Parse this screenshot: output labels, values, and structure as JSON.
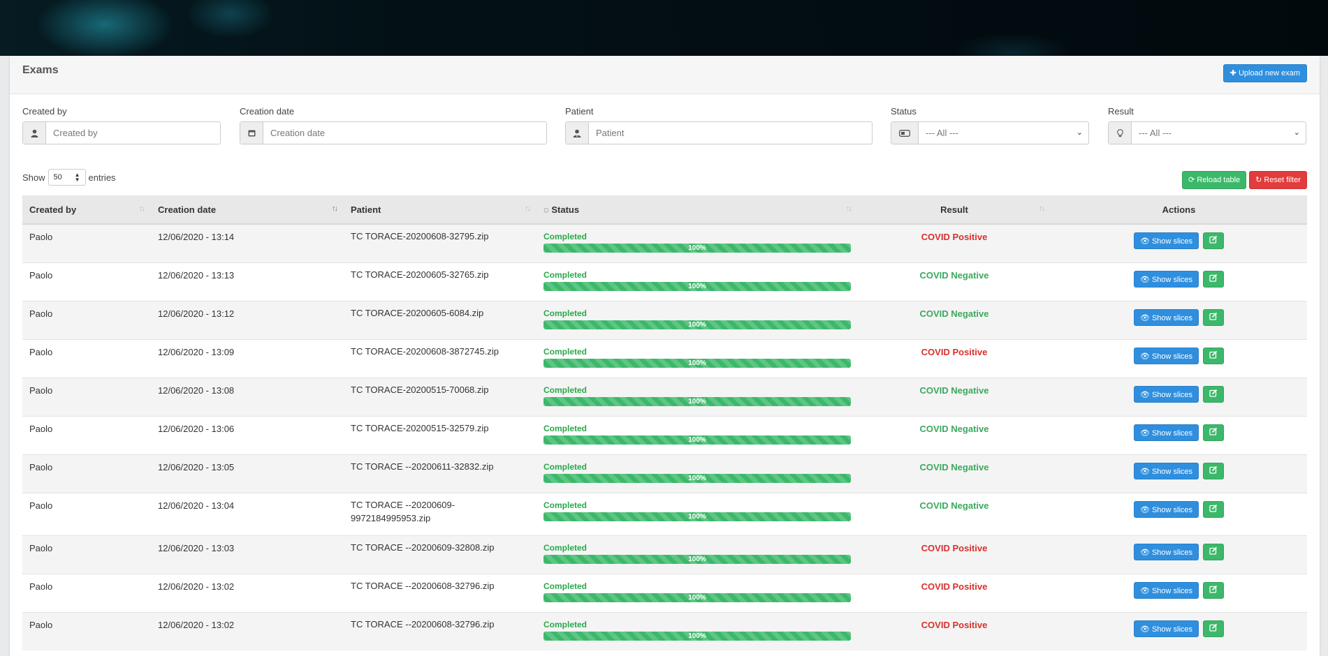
{
  "page": {
    "title": "Exams",
    "upload_button": "Upload new exam"
  },
  "filters": [
    {
      "label": "Created by",
      "placeholder": "Created by",
      "icon": "user-icon"
    },
    {
      "label": "Creation date",
      "placeholder": "Creation date",
      "icon": "calendar-icon"
    },
    {
      "label": "Patient",
      "placeholder": "Patient",
      "icon": "patient-icon"
    },
    {
      "label": "Status",
      "value": "--- All ---",
      "icon": "toggle-icon"
    },
    {
      "label": "Result",
      "value": "--- All ---",
      "icon": "lightbulb-icon"
    }
  ],
  "length_menu": {
    "prefix": "Show",
    "value": "50",
    "suffix": "entries"
  },
  "table_buttons": {
    "reload": "Reload table",
    "reset": "Reset filter"
  },
  "columns": [
    "Created by",
    "Creation date",
    "Patient",
    "Status",
    "Result",
    "Actions"
  ],
  "action_labels": {
    "show_slices": "Show slices"
  },
  "rows": [
    {
      "created_by": "Paolo",
      "date": "12/06/2020 - 13:14",
      "patient": "TC TORACE-20200608-32795.zip",
      "status": "Completed",
      "progress": "100%",
      "result": "COVID Positive"
    },
    {
      "created_by": "Paolo",
      "date": "12/06/2020 - 13:13",
      "patient": "TC TORACE-20200605-32765.zip",
      "status": "Completed",
      "progress": "100%",
      "result": "COVID Negative"
    },
    {
      "created_by": "Paolo",
      "date": "12/06/2020 - 13:12",
      "patient": "TC TORACE-20200605-6084.zip",
      "status": "Completed",
      "progress": "100%",
      "result": "COVID Negative"
    },
    {
      "created_by": "Paolo",
      "date": "12/06/2020 - 13:09",
      "patient": "TC TORACE-20200608-3872745.zip",
      "status": "Completed",
      "progress": "100%",
      "result": "COVID Positive"
    },
    {
      "created_by": "Paolo",
      "date": "12/06/2020 - 13:08",
      "patient": "TC TORACE-20200515-70068.zip",
      "status": "Completed",
      "progress": "100%",
      "result": "COVID Negative"
    },
    {
      "created_by": "Paolo",
      "date": "12/06/2020 - 13:06",
      "patient": "TC TORACE-20200515-32579.zip",
      "status": "Completed",
      "progress": "100%",
      "result": "COVID Negative"
    },
    {
      "created_by": "Paolo",
      "date": "12/06/2020 - 13:05",
      "patient": "TC TORACE --20200611-32832.zip",
      "status": "Completed",
      "progress": "100%",
      "result": "COVID Negative"
    },
    {
      "created_by": "Paolo",
      "date": "12/06/2020 - 13:04",
      "patient": "TC TORACE --20200609-\n9972184995953.zip",
      "status": "Completed",
      "progress": "100%",
      "result": "COVID Negative"
    },
    {
      "created_by": "Paolo",
      "date": "12/06/2020 - 13:03",
      "patient": "TC TORACE --20200609-32808.zip",
      "status": "Completed",
      "progress": "100%",
      "result": "COVID Positive"
    },
    {
      "created_by": "Paolo",
      "date": "12/06/2020 - 13:02",
      "patient": "TC TORACE --20200608-32796.zip",
      "status": "Completed",
      "progress": "100%",
      "result": "COVID Positive"
    },
    {
      "created_by": "Paolo",
      "date": "12/06/2020 - 13:02",
      "patient": "TC TORACE --20200608-32796.zip",
      "status": "Completed",
      "progress": "100%",
      "result": "COVID Positive"
    }
  ]
}
